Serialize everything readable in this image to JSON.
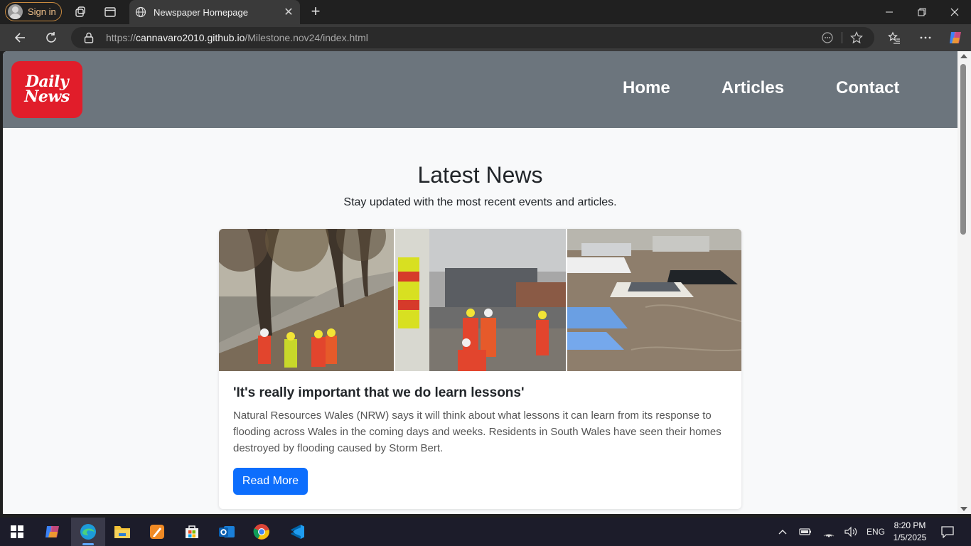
{
  "browser": {
    "signin_label": "Sign in",
    "tab_title": "Newspaper Homepage",
    "url_scheme": "https://",
    "url_host": "cannavaro2010.github.io",
    "url_path": "/Milestone.nov24/index.html"
  },
  "site": {
    "logo_line1": "Daily",
    "logo_line2": "News",
    "nav": [
      "Home",
      "Articles",
      "Contact"
    ],
    "hero_title": "Latest News",
    "hero_subtitle": "Stay updated with the most recent events and articles.",
    "article": {
      "title": "'It's really important that we do learn lessons'",
      "body": "Natural Resources Wales (NRW) says it will think about what lessons it can learn from its response to flooding across Wales in the coming days and weeks. Residents in South Wales have seen their homes destroyed by flooding caused by Storm Bert.",
      "button": "Read More"
    },
    "colors": {
      "header": "#6c757d",
      "logo": "#e11d2a",
      "button": "#0d6efd"
    }
  },
  "taskbar": {
    "apps": [
      "windows-start",
      "copilot",
      "edge",
      "file-explorer",
      "pencil-app",
      "microsoft-store",
      "outlook",
      "chrome",
      "vscode"
    ],
    "language": "ENG",
    "time": "8:20 PM",
    "date": "1/5/2025"
  }
}
